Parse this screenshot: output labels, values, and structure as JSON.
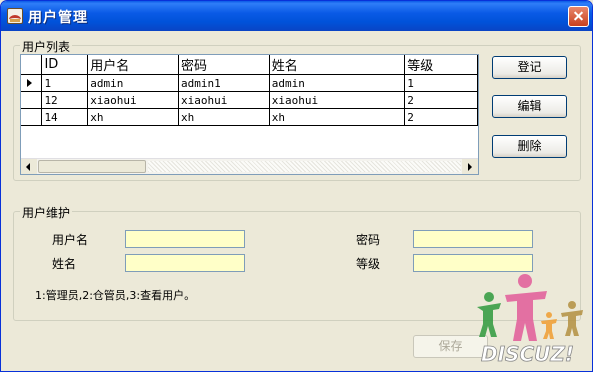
{
  "window": {
    "title": "用户管理"
  },
  "user_list": {
    "legend": "用户列表",
    "columns": [
      "ID",
      "用户名",
      "密码",
      "姓名",
      "等级"
    ],
    "rows": [
      {
        "id": "1",
        "username": "admin",
        "password": "admin1",
        "name": "admin",
        "level": "1",
        "current": true
      },
      {
        "id": "12",
        "username": "xiaohui",
        "password": "xiaohui",
        "name": "xiaohui",
        "level": "2",
        "current": false
      },
      {
        "id": "14",
        "username": "xh",
        "password": "xh",
        "name": "xh",
        "level": "2",
        "current": false
      }
    ]
  },
  "actions": {
    "register": "登记",
    "edit": "编辑",
    "delete": "删除"
  },
  "maintenance": {
    "legend": "用户维护",
    "username_label": "用户名",
    "password_label": "密码",
    "name_label": "姓名",
    "level_label": "等级",
    "username_value": "",
    "password_value": "",
    "name_value": "",
    "level_value": "",
    "note": "1:管理员,2:仓管员,3:查看用户。"
  },
  "footer": {
    "save": "保存"
  },
  "watermark": {
    "text": "DISCUZ!",
    "colors": [
      "#3a9e46",
      "#e3649d",
      "#f0a23a",
      "#b6954a"
    ]
  },
  "colors": {
    "titlebar": "#0a5ae6",
    "input_bg": "#ffffc8",
    "window_bg": "#ece9d8"
  }
}
